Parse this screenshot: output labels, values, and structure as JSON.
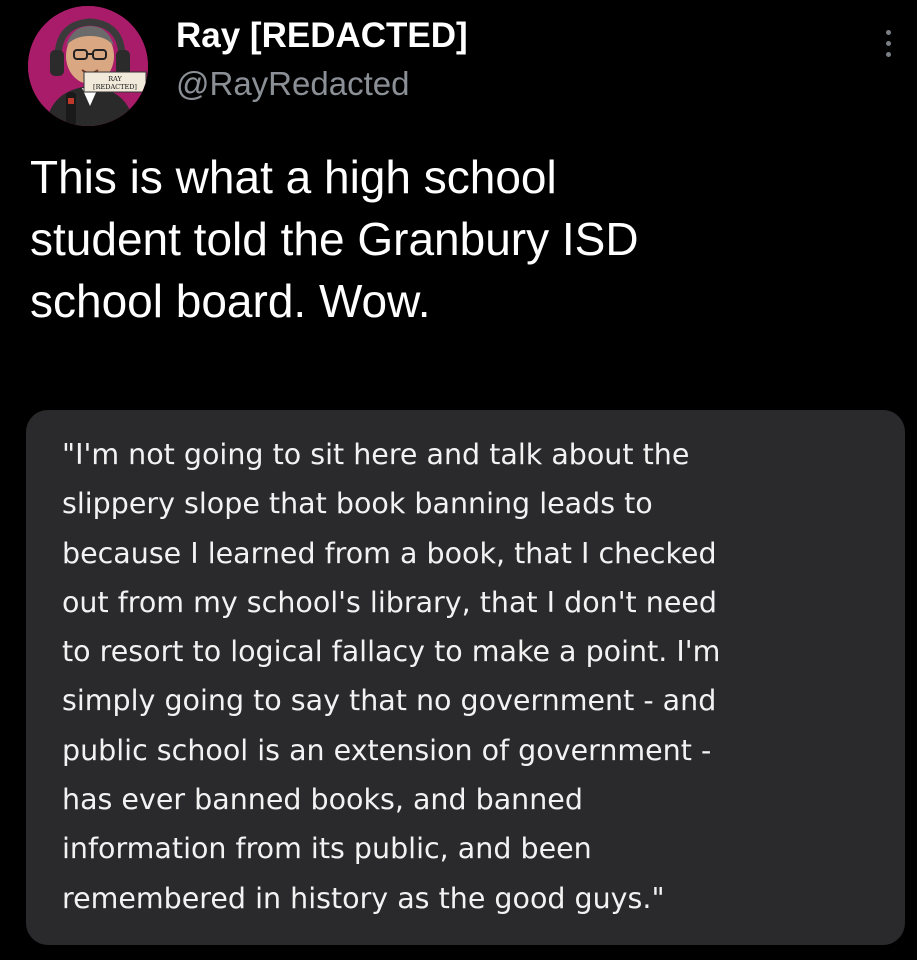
{
  "author": {
    "display_name": "Ray [REDACTED]",
    "handle": "@RayRedacted",
    "avatar_badge_line1": "RAY",
    "avatar_badge_line2": "REDACTED"
  },
  "tweet": {
    "text": "This is what a high school\nstudent told the Granbury ISD\nschool board. Wow."
  },
  "quote_image": {
    "text": "\"I'm not going to sit here and talk about the\nslippery slope that book banning leads to\nbecause I learned from a book, that I checked\nout from my school's library, that I don't need\nto resort to logical fallacy to make a point. I'm\nsimply going to say that no government - and\npublic school is an extension of government -\nhas ever banned books, and banned\ninformation from its public, and been\nremembered in history as the good guys.\""
  },
  "icons": {
    "more": "more-vertical-icon"
  },
  "colors": {
    "background": "#000000",
    "primary_text": "#ffffff",
    "secondary_text": "#8b9096",
    "card_background": "#2a2a2c",
    "avatar_background": "#a81c6a"
  }
}
